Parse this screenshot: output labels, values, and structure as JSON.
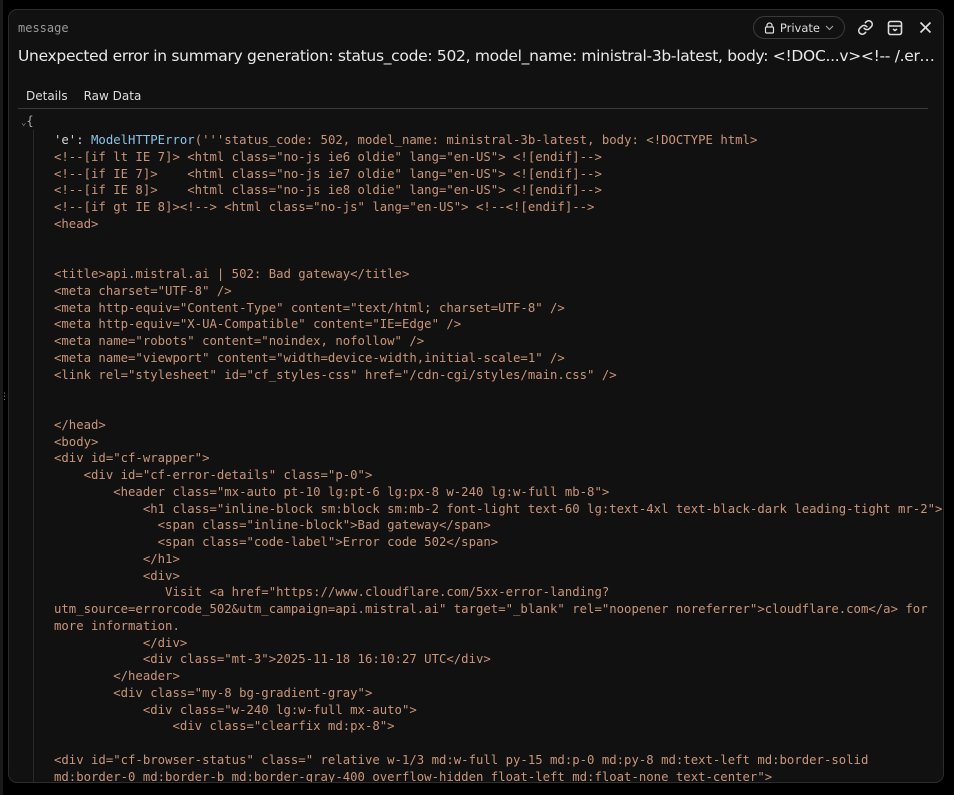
{
  "panel": {
    "label": "message",
    "title": "Unexpected error in summary generation: status_code: 502, model_name: ministral-3b-latest, body: <!DOC...v><!-- /.error-footer -->",
    "visibility": "Private"
  },
  "tabs": [
    {
      "label": "Details"
    },
    {
      "label": "Raw Data"
    }
  ],
  "tree": {
    "open_brace": "{"
  },
  "code": {
    "key": "'e':",
    "class_name": "ModelHTTPError",
    "first_line_rest": "('''status_code: 502, model_name: ministral-3b-latest, body: <!DOCTYPE html>",
    "lines": [
      "<!--[if lt IE 7]> <html class=\"no-js ie6 oldie\" lang=\"en-US\"> <![endif]-->",
      "<!--[if IE 7]>    <html class=\"no-js ie7 oldie\" lang=\"en-US\"> <![endif]-->",
      "<!--[if IE 8]>    <html class=\"no-js ie8 oldie\" lang=\"en-US\"> <![endif]-->",
      "<!--[if gt IE 8]><!--> <html class=\"no-js\" lang=\"en-US\"> <!--<![endif]-->",
      "<head>",
      "",
      "",
      "<title>api.mistral.ai | 502: Bad gateway</title>",
      "<meta charset=\"UTF-8\" />",
      "<meta http-equiv=\"Content-Type\" content=\"text/html; charset=UTF-8\" />",
      "<meta http-equiv=\"X-UA-Compatible\" content=\"IE=Edge\" />",
      "<meta name=\"robots\" content=\"noindex, nofollow\" />",
      "<meta name=\"viewport\" content=\"width=device-width,initial-scale=1\" />",
      "<link rel=\"stylesheet\" id=\"cf_styles-css\" href=\"/cdn-cgi/styles/main.css\" />",
      "",
      "",
      "</head>",
      "<body>",
      "<div id=\"cf-wrapper\">",
      "    <div id=\"cf-error-details\" class=\"p-0\">",
      "        <header class=\"mx-auto pt-10 lg:pt-6 lg:px-8 w-240 lg:w-full mb-8\">",
      "            <h1 class=\"inline-block sm:block sm:mb-2 font-light text-60 lg:text-4xl text-black-dark leading-tight mr-2\">",
      "              <span class=\"inline-block\">Bad gateway</span>",
      "              <span class=\"code-label\">Error code 502</span>",
      "            </h1>",
      "            <div>",
      "               Visit <a href=\"https://www.cloudflare.com/5xx-error-landing?",
      "utm_source=errorcode_502&utm_campaign=api.mistral.ai\" target=\"_blank\" rel=\"noopener noreferrer\">cloudflare.com</a> for",
      "more information.",
      "            </div>",
      "            <div class=\"mt-3\">2025-11-18 16:10:27 UTC</div>",
      "        </header>",
      "        <div class=\"my-8 bg-gradient-gray\">",
      "            <div class=\"w-240 lg:w-full mx-auto\">",
      "                <div class=\"clearfix md:px-8\">",
      "",
      "<div id=\"cf-browser-status\" class=\" relative w-1/3 md:w-full py-15 md:p-0 md:py-8 md:text-left md:border-solid",
      "md:border-0 md:border-b md:border-gray-400 overflow-hidden float-left md:float-none text-center\">"
    ]
  }
}
